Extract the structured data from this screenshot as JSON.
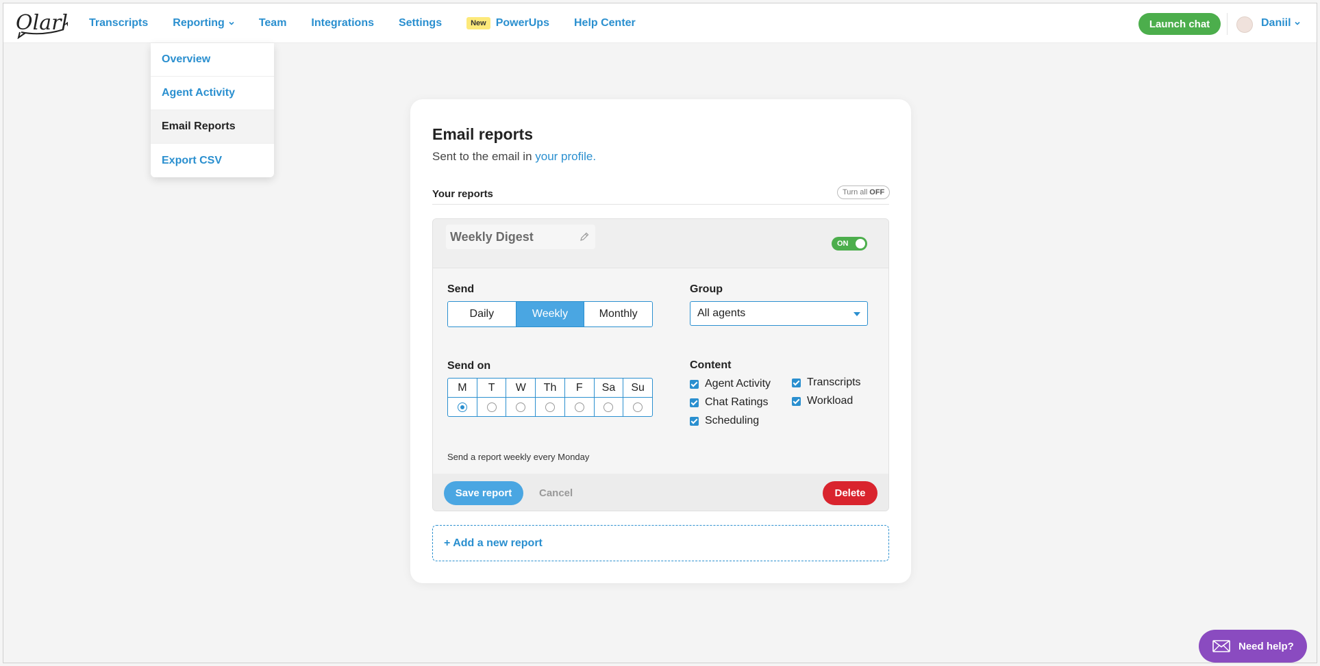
{
  "brand": {
    "logo_text": "Olark"
  },
  "nav": {
    "items": [
      {
        "label": "Transcripts"
      },
      {
        "label": "Reporting"
      },
      {
        "label": "Team"
      },
      {
        "label": "Integrations"
      },
      {
        "label": "Settings"
      },
      {
        "label": "PowerUps",
        "badge": "New"
      },
      {
        "label": "Help Center"
      }
    ],
    "launch_chat": "Launch chat",
    "user_name": "Daniil"
  },
  "reporting_menu": {
    "items": [
      {
        "label": "Overview"
      },
      {
        "label": "Agent Activity"
      },
      {
        "label": "Email Reports",
        "active": true
      },
      {
        "label": "Export CSV"
      }
    ]
  },
  "page": {
    "title": "Email reports",
    "subtitle_prefix": "Sent to the email in",
    "subtitle_link": "your profile.",
    "your_reports": "Your reports",
    "turn_all_prefix": "Turn all",
    "turn_all_state": "OFF",
    "add_new": "+ Add a new report"
  },
  "report": {
    "name": "Weekly Digest",
    "toggle_label": "ON",
    "send_label": "Send",
    "frequency_options": [
      "Daily",
      "Weekly",
      "Monthly"
    ],
    "frequency_selected": "Weekly",
    "group_label": "Group",
    "group_value": "All agents",
    "send_on_label": "Send on",
    "days": [
      "M",
      "T",
      "W",
      "Th",
      "F",
      "Sa",
      "Su"
    ],
    "day_selected": "M",
    "content_label": "Content",
    "content_items": [
      {
        "label": "Agent Activity",
        "checked": true
      },
      {
        "label": "Chat Ratings",
        "checked": true
      },
      {
        "label": "Scheduling",
        "checked": true
      },
      {
        "label": "Transcripts",
        "checked": true
      },
      {
        "label": "Workload",
        "checked": true
      }
    ],
    "summary": "Send a report weekly every Monday",
    "save": "Save report",
    "cancel": "Cancel",
    "delete": "Delete"
  },
  "help": {
    "label": "Need help?"
  },
  "colors": {
    "link": "#2a8fcf",
    "launch": "#4cae4c",
    "delete": "#d9242e",
    "help": "#8a4bc0",
    "selected": "#4aa6e2"
  }
}
